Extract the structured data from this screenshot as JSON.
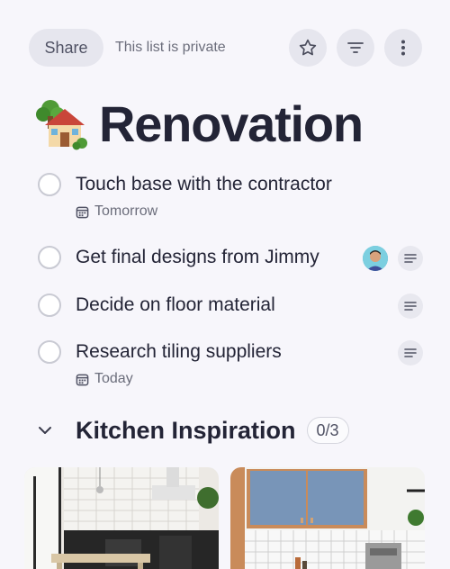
{
  "header": {
    "share_label": "Share",
    "privacy_text": "This list is private",
    "icons": [
      "star-icon",
      "filter-icon",
      "more-vertical-icon"
    ]
  },
  "list": {
    "emoji": "house-with-garden",
    "title": "Renovation"
  },
  "tasks": [
    {
      "label": "Touch base with the contractor",
      "due": "Tomorrow",
      "has_notes": false,
      "has_assignee": false
    },
    {
      "label": "Get final designs from Jimmy",
      "due": "",
      "has_notes": true,
      "has_assignee": true
    },
    {
      "label": "Decide on floor material",
      "due": "",
      "has_notes": true,
      "has_assignee": false
    },
    {
      "label": "Research tiling suppliers",
      "due": "Today",
      "has_notes": true,
      "has_assignee": false
    }
  ],
  "section": {
    "title": "Kitchen Inspiration",
    "count": "0/3",
    "expanded": true
  },
  "colors": {
    "background": "#f7f6fb",
    "text": "#232436",
    "muted": "#6b6d7b",
    "button_bg": "#e6e6ee",
    "checkbox_border": "#c9cad3"
  }
}
